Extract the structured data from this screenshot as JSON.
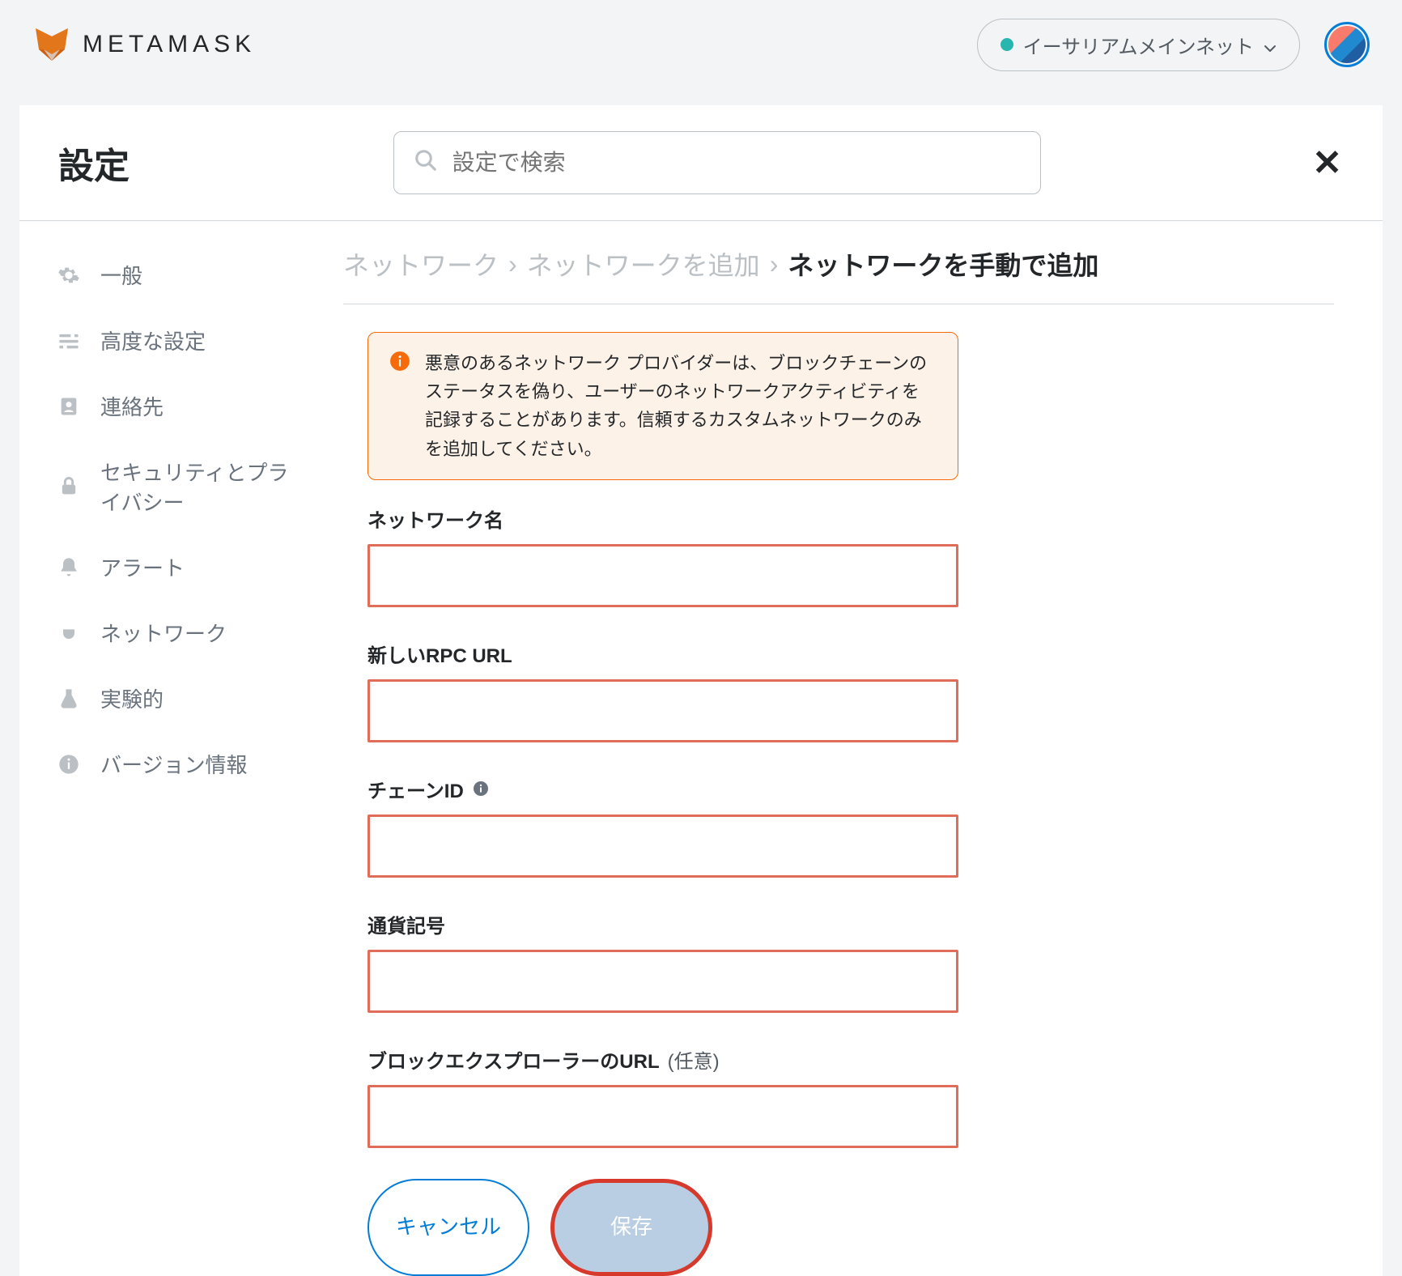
{
  "brand": {
    "name": "METAMASK"
  },
  "network": {
    "label": "イーサリアムメインネット"
  },
  "settings": {
    "title": "設定",
    "search_placeholder": "設定で検索"
  },
  "sidebar": {
    "items": [
      {
        "label": "一般"
      },
      {
        "label": "高度な設定"
      },
      {
        "label": "連絡先"
      },
      {
        "label": "セキュリティとプライバシー"
      },
      {
        "label": "アラート"
      },
      {
        "label": "ネットワーク"
      },
      {
        "label": "実験的"
      },
      {
        "label": "バージョン情報"
      }
    ]
  },
  "breadcrumb": {
    "a": "ネットワーク",
    "b": "ネットワークを追加",
    "c": "ネットワークを手動で追加"
  },
  "warning": {
    "text": "悪意のあるネットワーク プロバイダーは、ブロックチェーンのステータスを偽り、ユーザーのネットワークアクティビティを記録することがあります。信頼するカスタムネットワークのみを追加してください。"
  },
  "form": {
    "network_name_label": "ネットワーク名",
    "rpc_url_label": "新しいRPC URL",
    "chain_id_label": "チェーンID",
    "currency_symbol_label": "通貨記号",
    "block_explorer_label": "ブロックエクスプローラーのURL",
    "optional_text": "(任意)"
  },
  "actions": {
    "cancel": "キャンセル",
    "save": "保存"
  }
}
